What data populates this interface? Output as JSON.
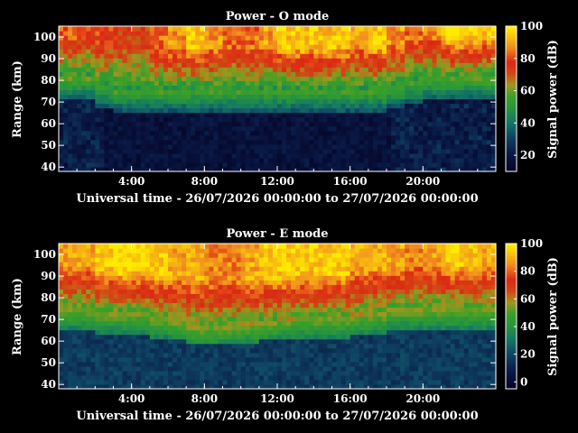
{
  "chart_data": [
    {
      "type": "heatmap",
      "title": "Power - O mode",
      "xlabel": "Universal time - 26/07/2026 00:00:00 to 27/07/2026 00:00:00",
      "ylabel": "Range (km)",
      "colorbar_label": "Signal power (dB)",
      "x_ticks": [
        "4:00",
        "8:00",
        "12:00",
        "16:00",
        "20:00"
      ],
      "x_tick_hours": [
        4,
        8,
        12,
        16,
        20
      ],
      "xlim_hours": [
        0,
        24
      ],
      "y_ticks": [
        40,
        50,
        60,
        70,
        80,
        90,
        100
      ],
      "ylim": [
        38,
        105
      ],
      "colorbar_ticks": [
        20,
        40,
        60,
        80,
        100
      ],
      "colorbar_range": [
        10,
        100
      ],
      "description_grid": {
        "hours": [
          0.5,
          1.5,
          2.5,
          3.5,
          4.5,
          5.5,
          6.5,
          7.5,
          8.5,
          9.5,
          10.5,
          11.5,
          12.5,
          13.5,
          14.5,
          15.5,
          16.5,
          17.5,
          18.5,
          19.5,
          20.5,
          21.5,
          22.5,
          23.5
        ],
        "noise_floor_top_km": [
          75,
          75,
          72,
          70,
          70,
          70,
          70,
          70,
          70,
          70,
          70,
          70,
          70,
          70,
          70,
          70,
          70,
          70,
          72,
          74,
          75,
          75,
          75,
          75
        ],
        "peak_power_db": [
          85,
          80,
          80,
          75,
          75,
          85,
          90,
          95,
          90,
          85,
          85,
          90,
          95,
          95,
          95,
          95,
          90,
          95,
          90,
          85,
          90,
          100,
          100,
          95
        ]
      }
    },
    {
      "type": "heatmap",
      "title": "Power - E mode",
      "xlabel": "Universal time - 26/07/2026 00:00:00 to 27/07/2026 00:00:00",
      "ylabel": "Range (km)",
      "colorbar_label": "Signal power (dB)",
      "x_ticks": [
        "4:00",
        "8:00",
        "12:00",
        "16:00",
        "20:00"
      ],
      "x_tick_hours": [
        4,
        8,
        12,
        16,
        20
      ],
      "xlim_hours": [
        0,
        24
      ],
      "y_ticks": [
        40,
        50,
        60,
        70,
        80,
        90,
        100
      ],
      "ylim": [
        38,
        105
      ],
      "colorbar_ticks": [
        0,
        20,
        40,
        60,
        80,
        100
      ],
      "colorbar_range": [
        -5,
        100
      ],
      "description_grid": {
        "hours": [
          0.5,
          1.5,
          2.5,
          3.5,
          4.5,
          5.5,
          6.5,
          7.5,
          8.5,
          9.5,
          10.5,
          11.5,
          12.5,
          13.5,
          14.5,
          15.5,
          16.5,
          17.5,
          18.5,
          19.5,
          20.5,
          21.5,
          22.5,
          23.5
        ],
        "noise_floor_top_km": [
          70,
          70,
          68,
          68,
          68,
          66,
          64,
          62,
          62,
          62,
          63,
          64,
          65,
          66,
          66,
          66,
          67,
          68,
          70,
          70,
          70,
          70,
          70,
          70
        ],
        "peak_power_db": [
          90,
          90,
          95,
          100,
          100,
          95,
          90,
          90,
          85,
          85,
          90,
          95,
          95,
          95,
          95,
          95,
          90,
          90,
          90,
          85,
          90,
          95,
          95,
          90
        ]
      }
    }
  ]
}
